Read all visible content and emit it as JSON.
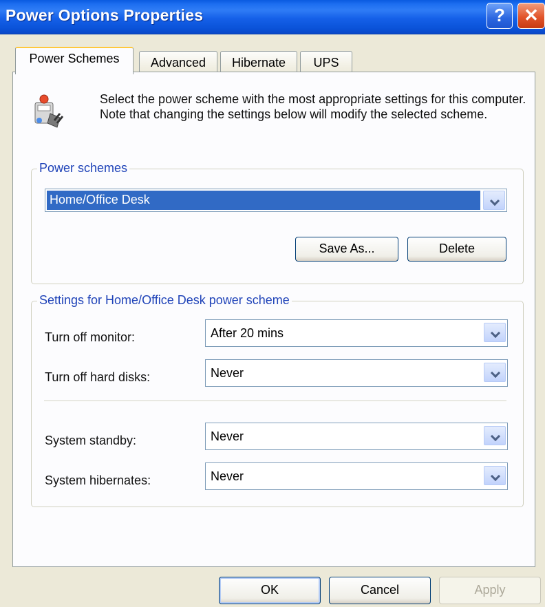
{
  "window": {
    "title": "Power Options Properties",
    "help_glyph": "?",
    "close_glyph": "✕"
  },
  "tabs": [
    {
      "label": "Power Schemes",
      "active": true
    },
    {
      "label": "Advanced",
      "active": false
    },
    {
      "label": "Hibernate",
      "active": false
    },
    {
      "label": "UPS",
      "active": false
    }
  ],
  "intro": {
    "icon": "power-scheme-icon",
    "text": "Select the power scheme with the most appropriate settings for this computer. Note that changing the settings below will modify the selected scheme."
  },
  "schemes": {
    "group_label": "Power schemes",
    "selected": "Home/Office Desk",
    "save_as_label": "Save As...",
    "delete_label": "Delete"
  },
  "settings": {
    "group_label": "Settings for Home/Office Desk power scheme",
    "rows": [
      {
        "label": "Turn off monitor:",
        "value": "After 20 mins"
      },
      {
        "label": "Turn off hard disks:",
        "value": "Never"
      },
      {
        "label": "System standby:",
        "value": "Never"
      },
      {
        "label": "System hibernates:",
        "value": "Never"
      }
    ]
  },
  "footer": {
    "ok_label": "OK",
    "cancel_label": "Cancel",
    "apply_label": "Apply",
    "apply_enabled": false
  },
  "colors": {
    "titlebar": "#0a5ae0",
    "selection": "#316ac5",
    "group_label": "#1f43b8",
    "active_tab_accent": "#ffc83c"
  }
}
